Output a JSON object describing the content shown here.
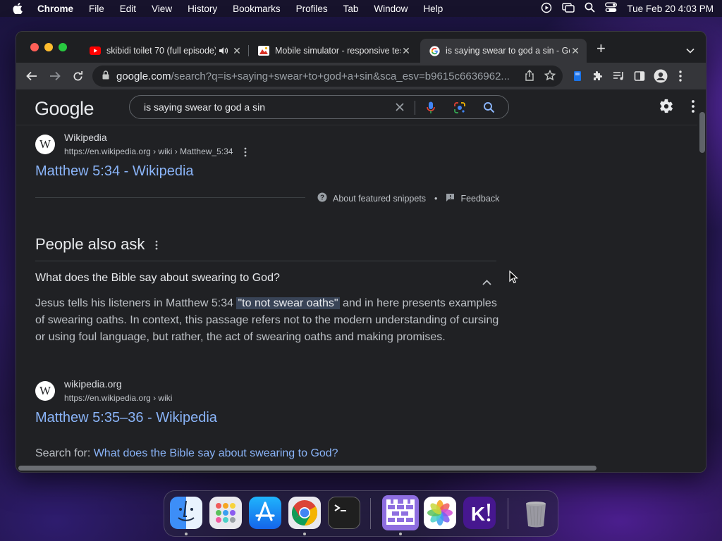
{
  "menubar": {
    "app_name": "Chrome",
    "items": [
      "File",
      "Edit",
      "View",
      "History",
      "Bookmarks",
      "Profiles",
      "Tab",
      "Window",
      "Help"
    ],
    "datetime": "Tue Feb 20  4:03 PM"
  },
  "tabs": [
    {
      "title": "skibidi toilet 70 (full episode)",
      "favicon": "youtube-icon",
      "audio": true,
      "active": false
    },
    {
      "title": "Mobile simulator - responsive testing",
      "favicon": "mobile-simulator-icon",
      "active": false
    },
    {
      "title": "is saying swear to god a sin - Google Search",
      "favicon": "google-icon",
      "active": true
    }
  ],
  "address_bar": {
    "domain": "google.com",
    "path": "/search?q=is+saying+swear+to+god+a+sin&sca_esv=b9615c6636962..."
  },
  "google": {
    "logo": "Google",
    "query": "is saying swear to god a sin"
  },
  "result_top": {
    "site": "Wikipedia",
    "url": "https://en.wikipedia.org › wiki › Matthew_5:34",
    "title": "Matthew 5:34 - Wikipedia"
  },
  "snippet_footer": {
    "about": "About featured snippets",
    "dot": "•",
    "feedback": "Feedback"
  },
  "paa": {
    "heading": "People also ask",
    "question": "What does the Bible say about swearing to God?",
    "answer_before": "Jesus tells his listeners in Matthew 5:34 ",
    "answer_highlight": "\"to not swear oaths\"",
    "answer_after": " and in here presents examples of swearing oaths. In context, this passage refers not to the modern understanding of cursing or using foul language, but rather, the act of swearing oaths and making promises.",
    "source_site": "wikipedia.org",
    "source_url": "https://en.wikipedia.org › wiki",
    "source_title": "Matthew 5:35–36 - Wikipedia",
    "search_for_label": "Search for: ",
    "search_for_link": "What does the Bible say about swearing to God?"
  },
  "favicon_letter": "W",
  "colors": {
    "link": "#8ab4f8",
    "page_bg": "#202124",
    "toolbar_bg": "#35363a"
  }
}
